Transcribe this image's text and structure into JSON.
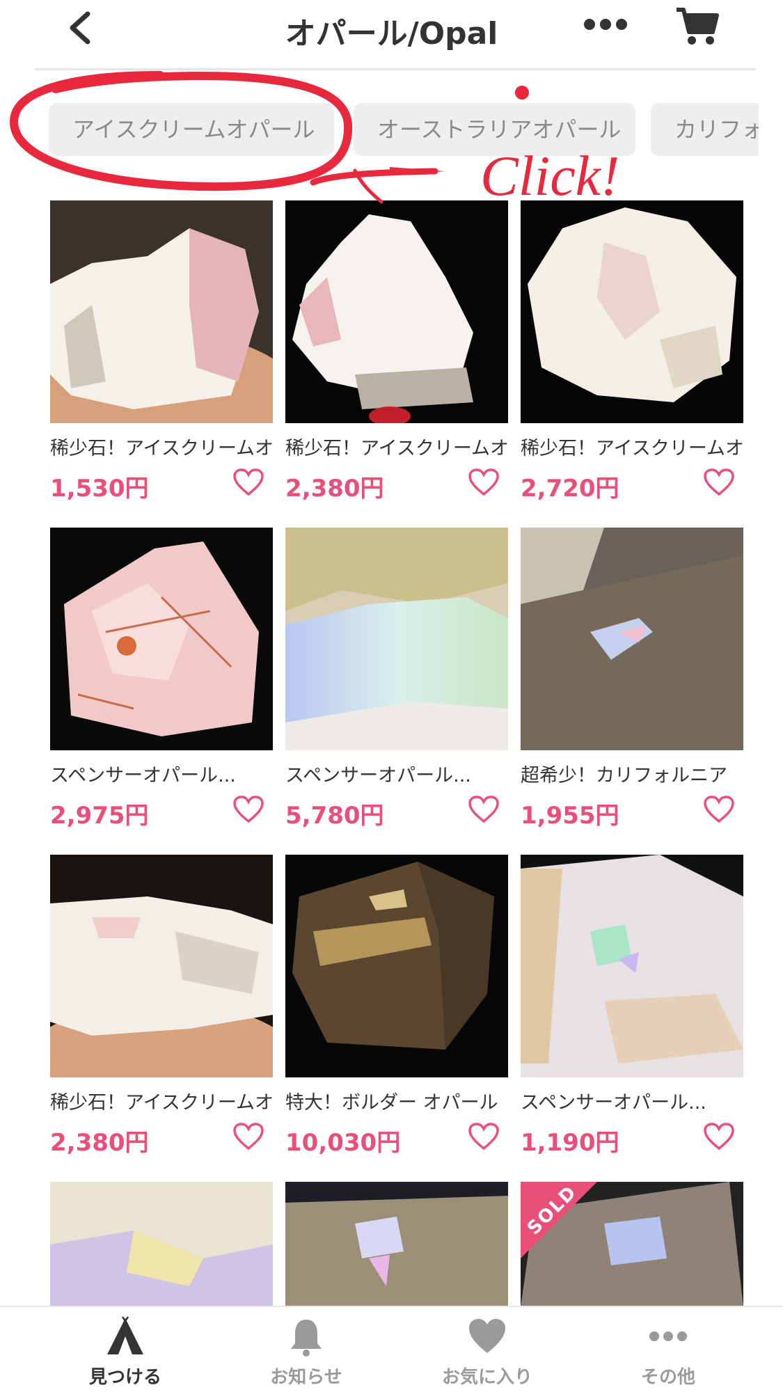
{
  "header": {
    "title": "オパール/Opal"
  },
  "chips": [
    {
      "label": "アイスクリームオパール"
    },
    {
      "label": "オーストラリアオパール"
    },
    {
      "label": "カリフォルニア"
    }
  ],
  "annotation": {
    "text": "Click!",
    "color": "#e8283c"
  },
  "products": [
    {
      "title": "稀少石！アイスクリームオパール",
      "price": "1,530円"
    },
    {
      "title": "稀少石！アイスクリームオパール",
      "price": "2,380円"
    },
    {
      "title": "稀少石！アイスクリームオパール",
      "price": "2,720円"
    },
    {
      "title": "スペンサーオパール...",
      "price": "2,975円"
    },
    {
      "title": "スペンサーオパール...",
      "price": "5,780円"
    },
    {
      "title": "超希少！カリフォルニア",
      "price": "1,955円"
    },
    {
      "title": "稀少石！アイスクリームオパール",
      "price": "2,380円"
    },
    {
      "title": "特大！ボルダー オパール",
      "price": "10,030円"
    },
    {
      "title": "スペンサーオパール...",
      "price": "1,190円"
    },
    {
      "title": "",
      "price": ""
    },
    {
      "title": "",
      "price": ""
    },
    {
      "title": "",
      "price": "",
      "badge": "SOLD"
    }
  ],
  "tabs": [
    {
      "label": "見つける",
      "icon": "tent-icon",
      "active": true
    },
    {
      "label": "お知らせ",
      "icon": "bell-icon"
    },
    {
      "label": "お気に入り",
      "icon": "heart-icon"
    },
    {
      "label": "その他",
      "icon": "more-dots-icon"
    }
  ],
  "colors": {
    "price": "#e8507a",
    "accent_annotation": "#e8283c",
    "chip_bg": "#eeeeee"
  }
}
